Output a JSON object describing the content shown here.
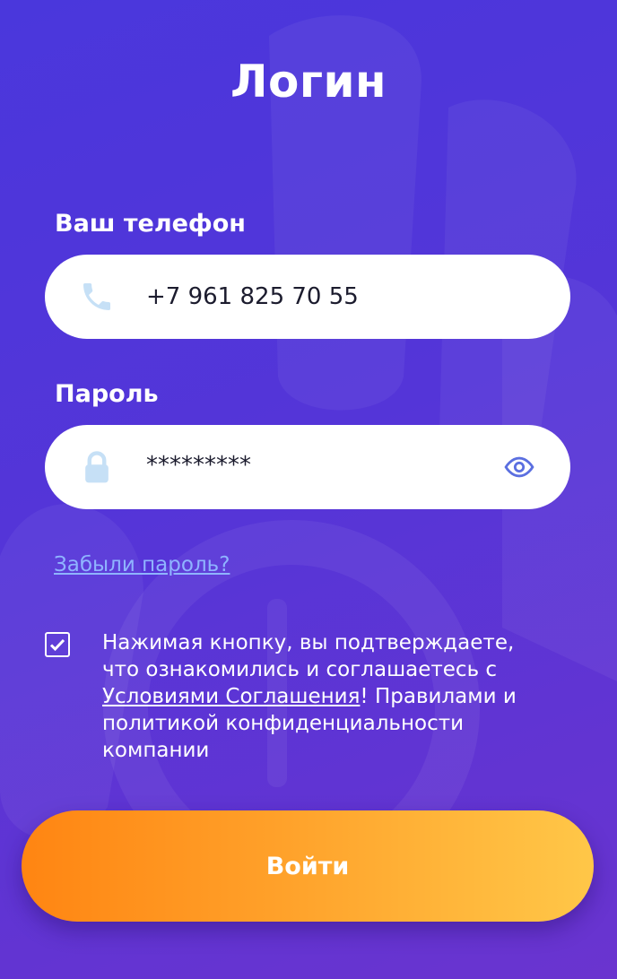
{
  "title": "Логин",
  "phone": {
    "label": "Ваш телефон",
    "value": "+7 961 825 70 55",
    "icon": "phone-icon"
  },
  "password": {
    "label": "Пароль",
    "value": "*********",
    "icon": "lock-icon",
    "toggle_icon": "eye-icon"
  },
  "forgot_link": "Забыли пароль?",
  "agreement": {
    "checked": true,
    "text_before": "Нажимая кнопку, вы подтверждаете, что ознакомились и соглашаетесь с ",
    "link_text": "Условиями Соглашения",
    "text_after": "! Правилами и политикой конфиденциальности компании"
  },
  "submit_label": "Войти",
  "colors": {
    "background": "#5435d8",
    "accent_orange": "#ff8512",
    "accent_yellow": "#ffc748",
    "link_blue": "#8fb4ff",
    "icon_light_blue": "#c6e0f6",
    "eye_blue": "#5b6fe0"
  }
}
